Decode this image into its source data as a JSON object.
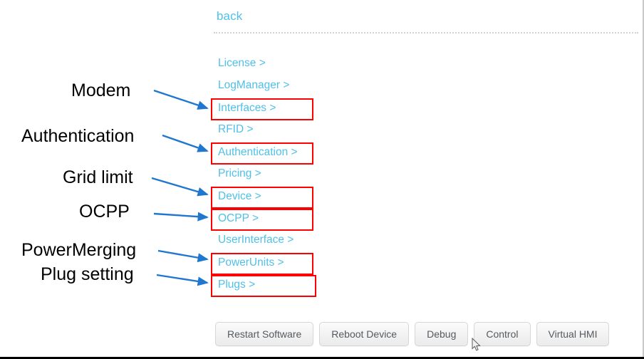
{
  "page": {
    "back_label": "back",
    "accent_link_color": "#4fc0e8",
    "highlight_box_color": "#ff0000",
    "arrow_color": "#1f77d0"
  },
  "menu": {
    "items": [
      {
        "label": "License >",
        "highlighted": false
      },
      {
        "label": "LogManager >",
        "highlighted": false
      },
      {
        "label": "Interfaces >",
        "highlighted": true
      },
      {
        "label": "RFID >",
        "highlighted": false
      },
      {
        "label": "Authentication >",
        "highlighted": true
      },
      {
        "label": "Pricing >",
        "highlighted": false
      },
      {
        "label": "Device >",
        "highlighted": true
      },
      {
        "label": "OCPP >",
        "highlighted": true
      },
      {
        "label": "UserInterface >",
        "highlighted": false
      },
      {
        "label": "PowerUnits >",
        "highlighted": true
      },
      {
        "label": "Plugs >",
        "highlighted": true
      }
    ]
  },
  "annotations": [
    {
      "text": "Modem",
      "target": "Interfaces >"
    },
    {
      "text": "Authentication",
      "target": "Authentication >"
    },
    {
      "text": "Grid limit",
      "target": "Device >"
    },
    {
      "text": "OCPP",
      "target": "OCPP >"
    },
    {
      "text": "PowerMerging",
      "target": "PowerUnits >"
    },
    {
      "text": "Plug setting",
      "target": "Plugs >"
    }
  ],
  "buttons": [
    {
      "label": "Restart Software"
    },
    {
      "label": "Reboot Device"
    },
    {
      "label": "Debug"
    },
    {
      "label": "Control"
    },
    {
      "label": "Virtual HMI"
    }
  ]
}
